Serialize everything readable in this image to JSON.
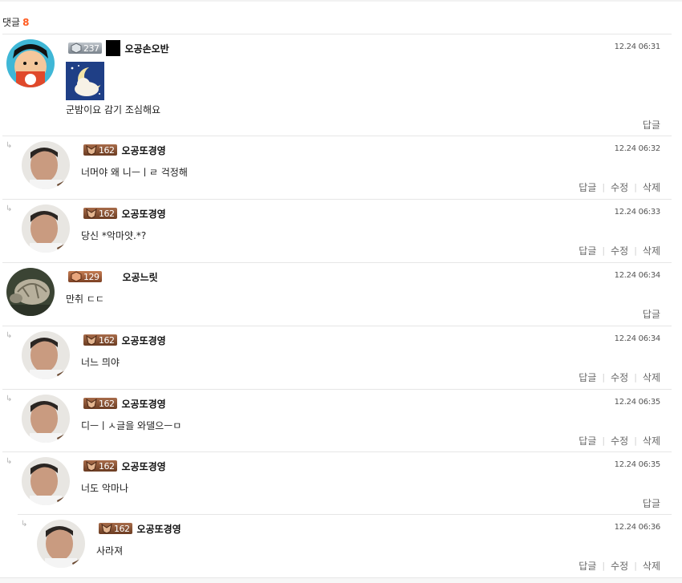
{
  "header": {
    "label": "댓글",
    "count": "8"
  },
  "labels": {
    "reply": "답글",
    "edit": "수정",
    "delete": "삭제"
  },
  "colors": {
    "accent": "#ff5a1f",
    "divider": "#e6e6e6"
  },
  "comments": [
    {
      "level": "237",
      "nickname": "오공손오반",
      "date": "12.24 06:31",
      "text": "군밤이요 감기 조심해요",
      "avatar": "cartoon-avatar",
      "sticker": "sleeping-moon-sticker",
      "is_reply": false
    },
    {
      "level": "162",
      "nickname": "오공또경영",
      "date": "12.24 06:32",
      "text": "너머야 왜 니ㅡㅣㄹ 걱정해",
      "avatar": "man-avatar",
      "is_reply": true
    },
    {
      "level": "162",
      "nickname": "오공또경영",
      "date": "12.24 06:33",
      "text": "당신 *악마얏.*?",
      "avatar": "man-avatar",
      "is_reply": true
    },
    {
      "level": "129",
      "nickname": "오공느릿",
      "date": "12.24 06:34",
      "text": "만취 ㄷㄷ",
      "avatar": "turtle-avatar",
      "is_reply": false
    },
    {
      "level": "162",
      "nickname": "오공또경영",
      "date": "12.24 06:34",
      "text": "너느 믜야",
      "avatar": "man-avatar",
      "is_reply": true
    },
    {
      "level": "162",
      "nickname": "오공또경영",
      "date": "12.24 06:35",
      "text": "디ㅡㅣㅅ글을 와댈으ㅡㅁ",
      "avatar": "man-avatar",
      "is_reply": true
    },
    {
      "level": "162",
      "nickname": "오공또경영",
      "date": "12.24 06:35",
      "text": "너도 악마나",
      "avatar": "man-avatar",
      "is_reply": true
    },
    {
      "level": "162",
      "nickname": "오공또경영",
      "date": "12.24 06:36",
      "text": "사라져",
      "avatar": "man-avatar",
      "is_reply": true
    }
  ]
}
